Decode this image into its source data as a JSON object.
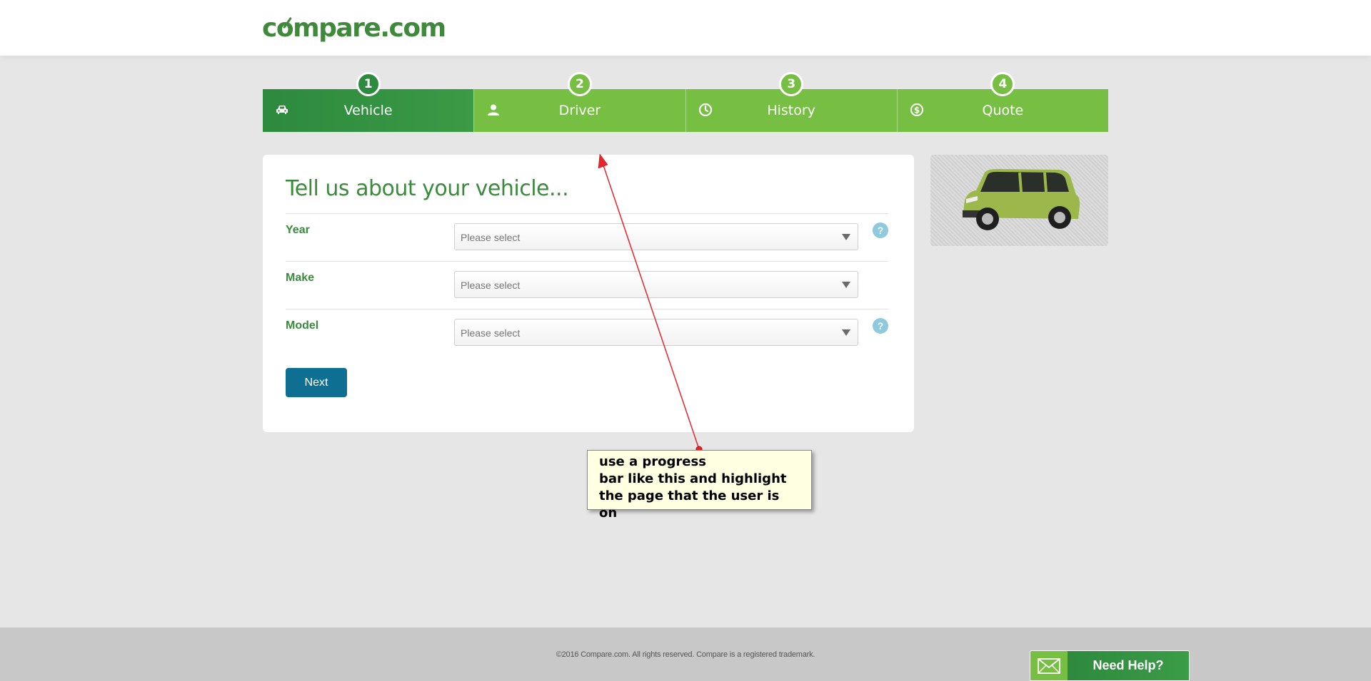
{
  "brand": {
    "logo_pre": "c",
    "logo_o": "o",
    "logo_post": "mpare.com"
  },
  "steps": [
    {
      "num": "1",
      "label": "Vehicle",
      "icon": "car-icon",
      "active": true
    },
    {
      "num": "2",
      "label": "Driver",
      "icon": "user-icon",
      "active": false
    },
    {
      "num": "3",
      "label": "History",
      "icon": "clock-icon",
      "active": false
    },
    {
      "num": "4",
      "label": "Quote",
      "icon": "dollar-icon",
      "active": false
    }
  ],
  "form": {
    "title": "Tell us about your vehicle...",
    "fields": [
      {
        "label": "Year",
        "placeholder": "Please select",
        "help": "?"
      },
      {
        "label": "Make",
        "placeholder": "Please select"
      },
      {
        "label": "Model",
        "placeholder": "Please select",
        "help": "?"
      }
    ],
    "next_label": "Next"
  },
  "annotation": {
    "lines": [
      "use a progress",
      "bar like this and highlight",
      "the page that the user is on"
    ]
  },
  "footer": {
    "copyright": "©2016 Compare.com. All rights reserved. Compare is a registered trademark.",
    "help_label": "Need Help?"
  },
  "colors": {
    "brand_green": "#3a8c3c",
    "step_active": "#2d8a3e",
    "step_inactive": "#76bf43",
    "button_blue": "#0e6f92",
    "help_icon": "#8ec9dc",
    "annotation_bg": "#ffffe1",
    "annotation_arrow": "#e8252a"
  }
}
